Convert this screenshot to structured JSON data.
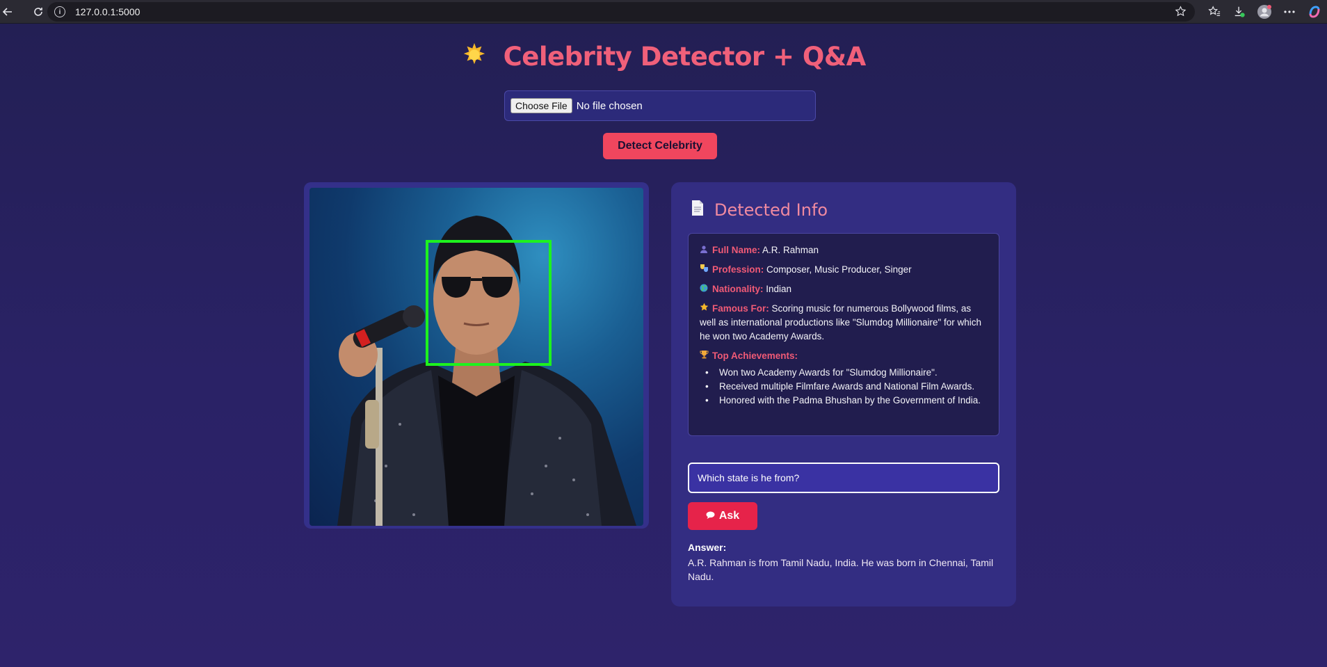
{
  "browser": {
    "url": "127.0.0.1:5000"
  },
  "page": {
    "title": "Celebrity Detector + Q&A",
    "title_icon": "sun-star-icon"
  },
  "upload": {
    "choose_label": "Choose File",
    "status": "No file chosen",
    "detect_label": "Detect Celebrity"
  },
  "info": {
    "heading": "Detected Info",
    "fields": [
      {
        "icon": "person-icon",
        "label": "Full Name:",
        "value": "A.R. Rahman"
      },
      {
        "icon": "masks-icon",
        "label": "Profession:",
        "value": "Composer, Music Producer, Singer"
      },
      {
        "icon": "globe-icon",
        "label": "Nationality:",
        "value": "Indian"
      },
      {
        "icon": "star-icon",
        "label": "Famous For:",
        "value": "Scoring music for numerous Bollywood films, as well as international productions like \"Slumdog Millionaire\" for which he won two Academy Awards."
      }
    ],
    "achievements_label": "Top Achievements:",
    "achievements": [
      "Won two Academy Awards for \"Slumdog Millionaire\".",
      "Received multiple Filmfare Awards and National Film Awards.",
      "Honored with the Padma Bhushan by the Government of India."
    ]
  },
  "qa": {
    "question_value": "Which state is he from?",
    "ask_label": "Ask",
    "answer_label": "Answer:",
    "answer_text": "A.R. Rahman is from Tamil Nadu, India. He was born in Chennai, Tamil Nadu."
  },
  "colors": {
    "accent": "#f0607a",
    "button": "#f0465e",
    "face_box": "#1ef21e",
    "panel": "#332d82"
  }
}
